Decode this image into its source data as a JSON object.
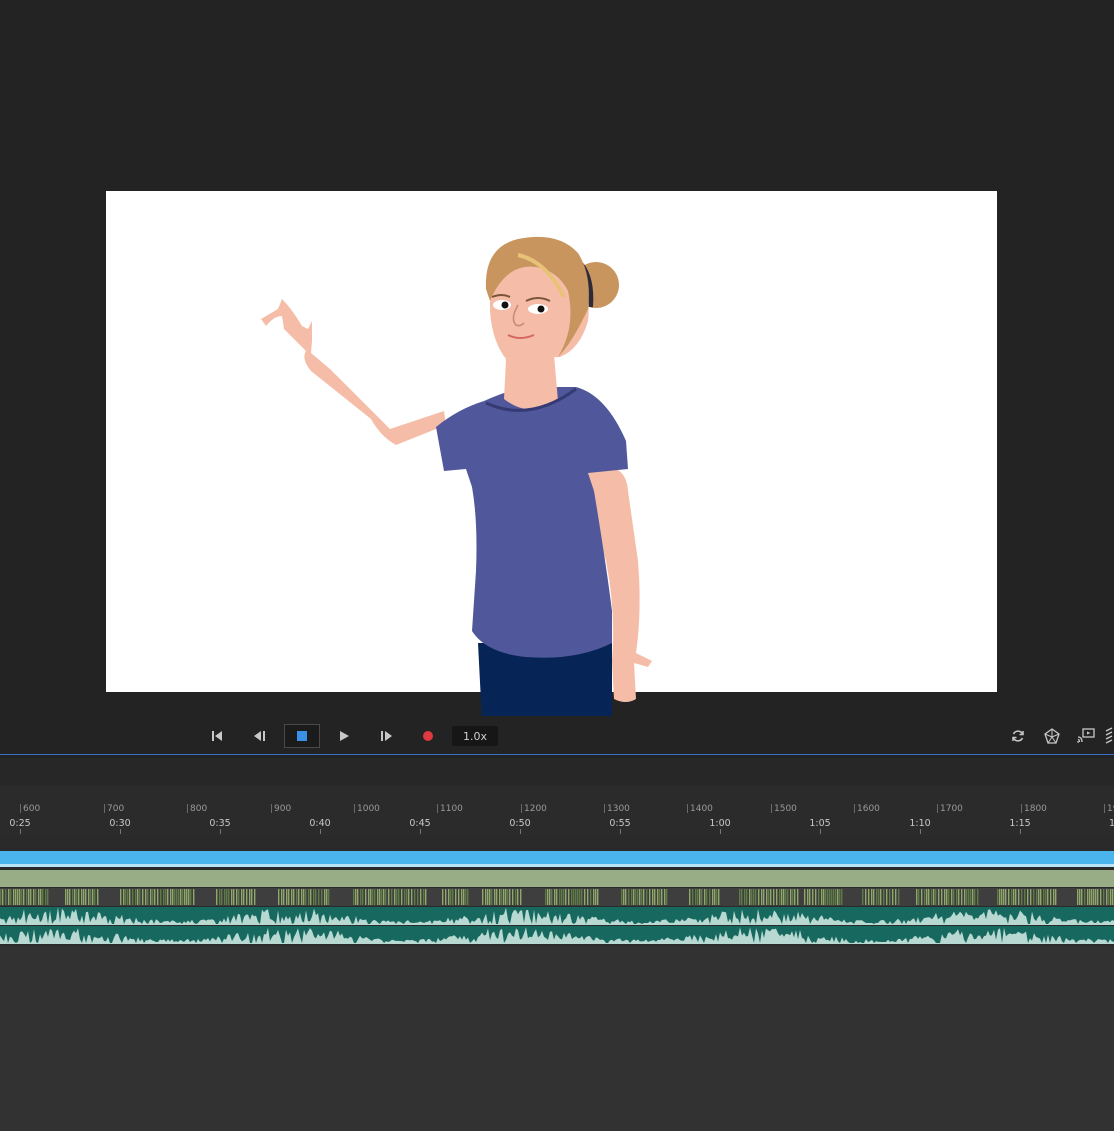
{
  "app": {
    "colors": {
      "panel_bg": "#232323",
      "accent_blue": "#3a72c8",
      "record_red": "#e0393e",
      "track_blue": "#4ab4ec",
      "track_green": "#98ad86",
      "audio_teal": "#17695f"
    }
  },
  "transport": {
    "buttons": [
      {
        "name": "go-to-start-button",
        "icon": "skip-to-start-icon"
      },
      {
        "name": "step-back-button",
        "icon": "step-back-icon"
      },
      {
        "name": "stop-button",
        "icon": "stop-icon"
      },
      {
        "name": "play-button",
        "icon": "play-icon"
      },
      {
        "name": "step-forward-button",
        "icon": "step-forward-icon"
      },
      {
        "name": "record-button",
        "icon": "record-icon"
      }
    ],
    "speed": "1.0x",
    "right_icons": [
      "refresh-icon",
      "rig-icon",
      "cast-icon",
      "grip-icon"
    ]
  },
  "timeline": {
    "frame_labels": [
      "600",
      "700",
      "800",
      "900",
      "1000",
      "1100",
      "1200",
      "1300",
      "1400",
      "1500",
      "1600",
      "1700",
      "1800",
      "19"
    ],
    "time_labels": [
      "0:25",
      "0:30",
      "0:35",
      "0:40",
      "0:45",
      "0:50",
      "0:55",
      "1:00",
      "1:05",
      "1:10",
      "1:15",
      "1"
    ]
  }
}
